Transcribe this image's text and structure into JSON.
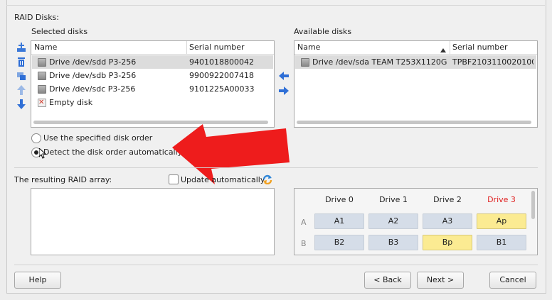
{
  "raid_disks": {
    "label": "RAID Disks:",
    "selected": {
      "label": "Selected disks",
      "columns": [
        "Name",
        "Serial number"
      ],
      "rows": [
        {
          "name": "Drive /dev/sdd P3-256",
          "serial": "9401018800042",
          "icon": "disk-icon",
          "selected": true
        },
        {
          "name": "Drive /dev/sdb P3-256",
          "serial": "9900922007418",
          "icon": "disk-icon",
          "selected": false
        },
        {
          "name": "Drive /dev/sdc P3-256",
          "serial": "9101225A00033",
          "icon": "disk-icon",
          "selected": false
        },
        {
          "name": "Empty disk",
          "serial": "",
          "icon": "empty-disk-icon",
          "selected": false
        }
      ]
    },
    "available": {
      "label": "Available disks",
      "columns": [
        "Name",
        "Serial number"
      ],
      "rows": [
        {
          "name": "Drive /dev/sda TEAM T253X1120G",
          "serial": "TPBF2103110020100...",
          "icon": "disk-icon",
          "selected": true
        }
      ]
    },
    "toolbar_icons": [
      "add-disk-icon",
      "remove-disk-icon",
      "replace-disk-icon",
      "move-up-icon",
      "move-down-icon"
    ]
  },
  "order": {
    "specified": "Use the specified disk order",
    "auto": "Detect the disk order automatically",
    "selected": "auto"
  },
  "result": {
    "label": "The resulting RAID array:",
    "update_auto": "Update automatically",
    "update_checked": false
  },
  "layout_grid": {
    "drives": [
      "Drive 0",
      "Drive 1",
      "Drive 2",
      "Drive 3"
    ],
    "highlight_drive": "Drive 3",
    "highlight_color": "#e02020",
    "rows": [
      {
        "label": "A",
        "blocks": [
          "A1",
          "A2",
          "A3",
          "Ap"
        ]
      },
      {
        "label": "B",
        "blocks": [
          "B2",
          "B3",
          "Bp",
          "B1"
        ]
      }
    ],
    "parity_color": "#fbeb92",
    "data_color": "#d5dde8"
  },
  "buttons": {
    "help": "Help",
    "back": "< Back",
    "next": "Next >",
    "cancel": "Cancel"
  },
  "annotation": {
    "arrow_color": "#ee1c1c"
  }
}
